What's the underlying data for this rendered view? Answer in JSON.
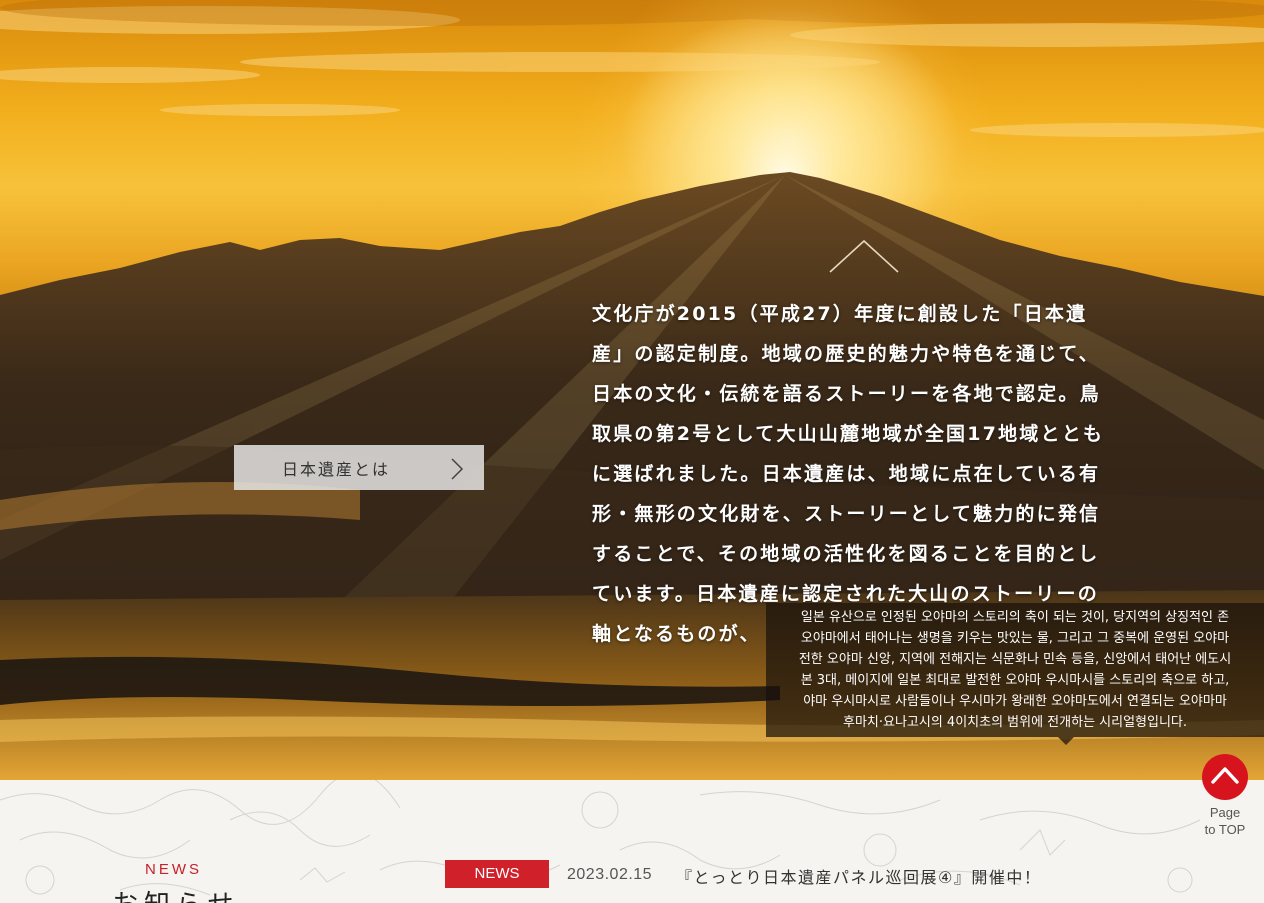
{
  "hero": {
    "intro_lines": [
      "文化庁が2015（平成27）年度に創設した「日本遺",
      "産」の認定制度。地域の歴史的魅力や特色を通じて、",
      "日本の文化・伝統を語るストーリーを各地で認定。鳥",
      "取県の第2号として大山山麓地域が全国17地域ととも",
      "に選ばれました。日本遺産は、地域に点在している有",
      "形・無形の文化財を、ストーリーとして魅力的に発信",
      "することで、その地域の活性化を図ることを目的とし",
      "ています。日本遺産に認定された大山のストーリーの",
      "軸となるものが、"
    ],
    "about_button_label": "日本遺産とは"
  },
  "translation_tooltip": {
    "lines": [
      "일본 유산으로 인정된 오야마의 스토리의 축이 되는 것이, 당지역의 상징적인 존",
      "오야마에서 태어나는 생명을 키우는 맛있는 물, 그리고 그 중복에 운영된 오야마",
      "전한 오야마 신앙, 지역에 전해지는 식문화나 민속 등을, 신앙에서 태어난 에도시",
      "본 3대, 메이지에 일본 최대로 발전한 오야마 우시마시를 스토리의 축으로 하고,",
      "야마 우시마시로 사람들이나 우시마가 왕래한 오야마도에서 연결되는 오야마마",
      "후마치·요나고시의 4이치초의 범위에 전개하는 시리얼형입니다."
    ]
  },
  "page_top": {
    "line1": "Page",
    "line2": "to TOP"
  },
  "news": {
    "label": "NEWS",
    "heading": "お知らせ",
    "item": {
      "badge": "NEWS",
      "date": "2023.02.15",
      "title": "『とっとり日本遺産パネル巡回展④』開催中！"
    }
  },
  "colors": {
    "accent": "#d0202a",
    "tooltip_bg": "#19120c"
  }
}
